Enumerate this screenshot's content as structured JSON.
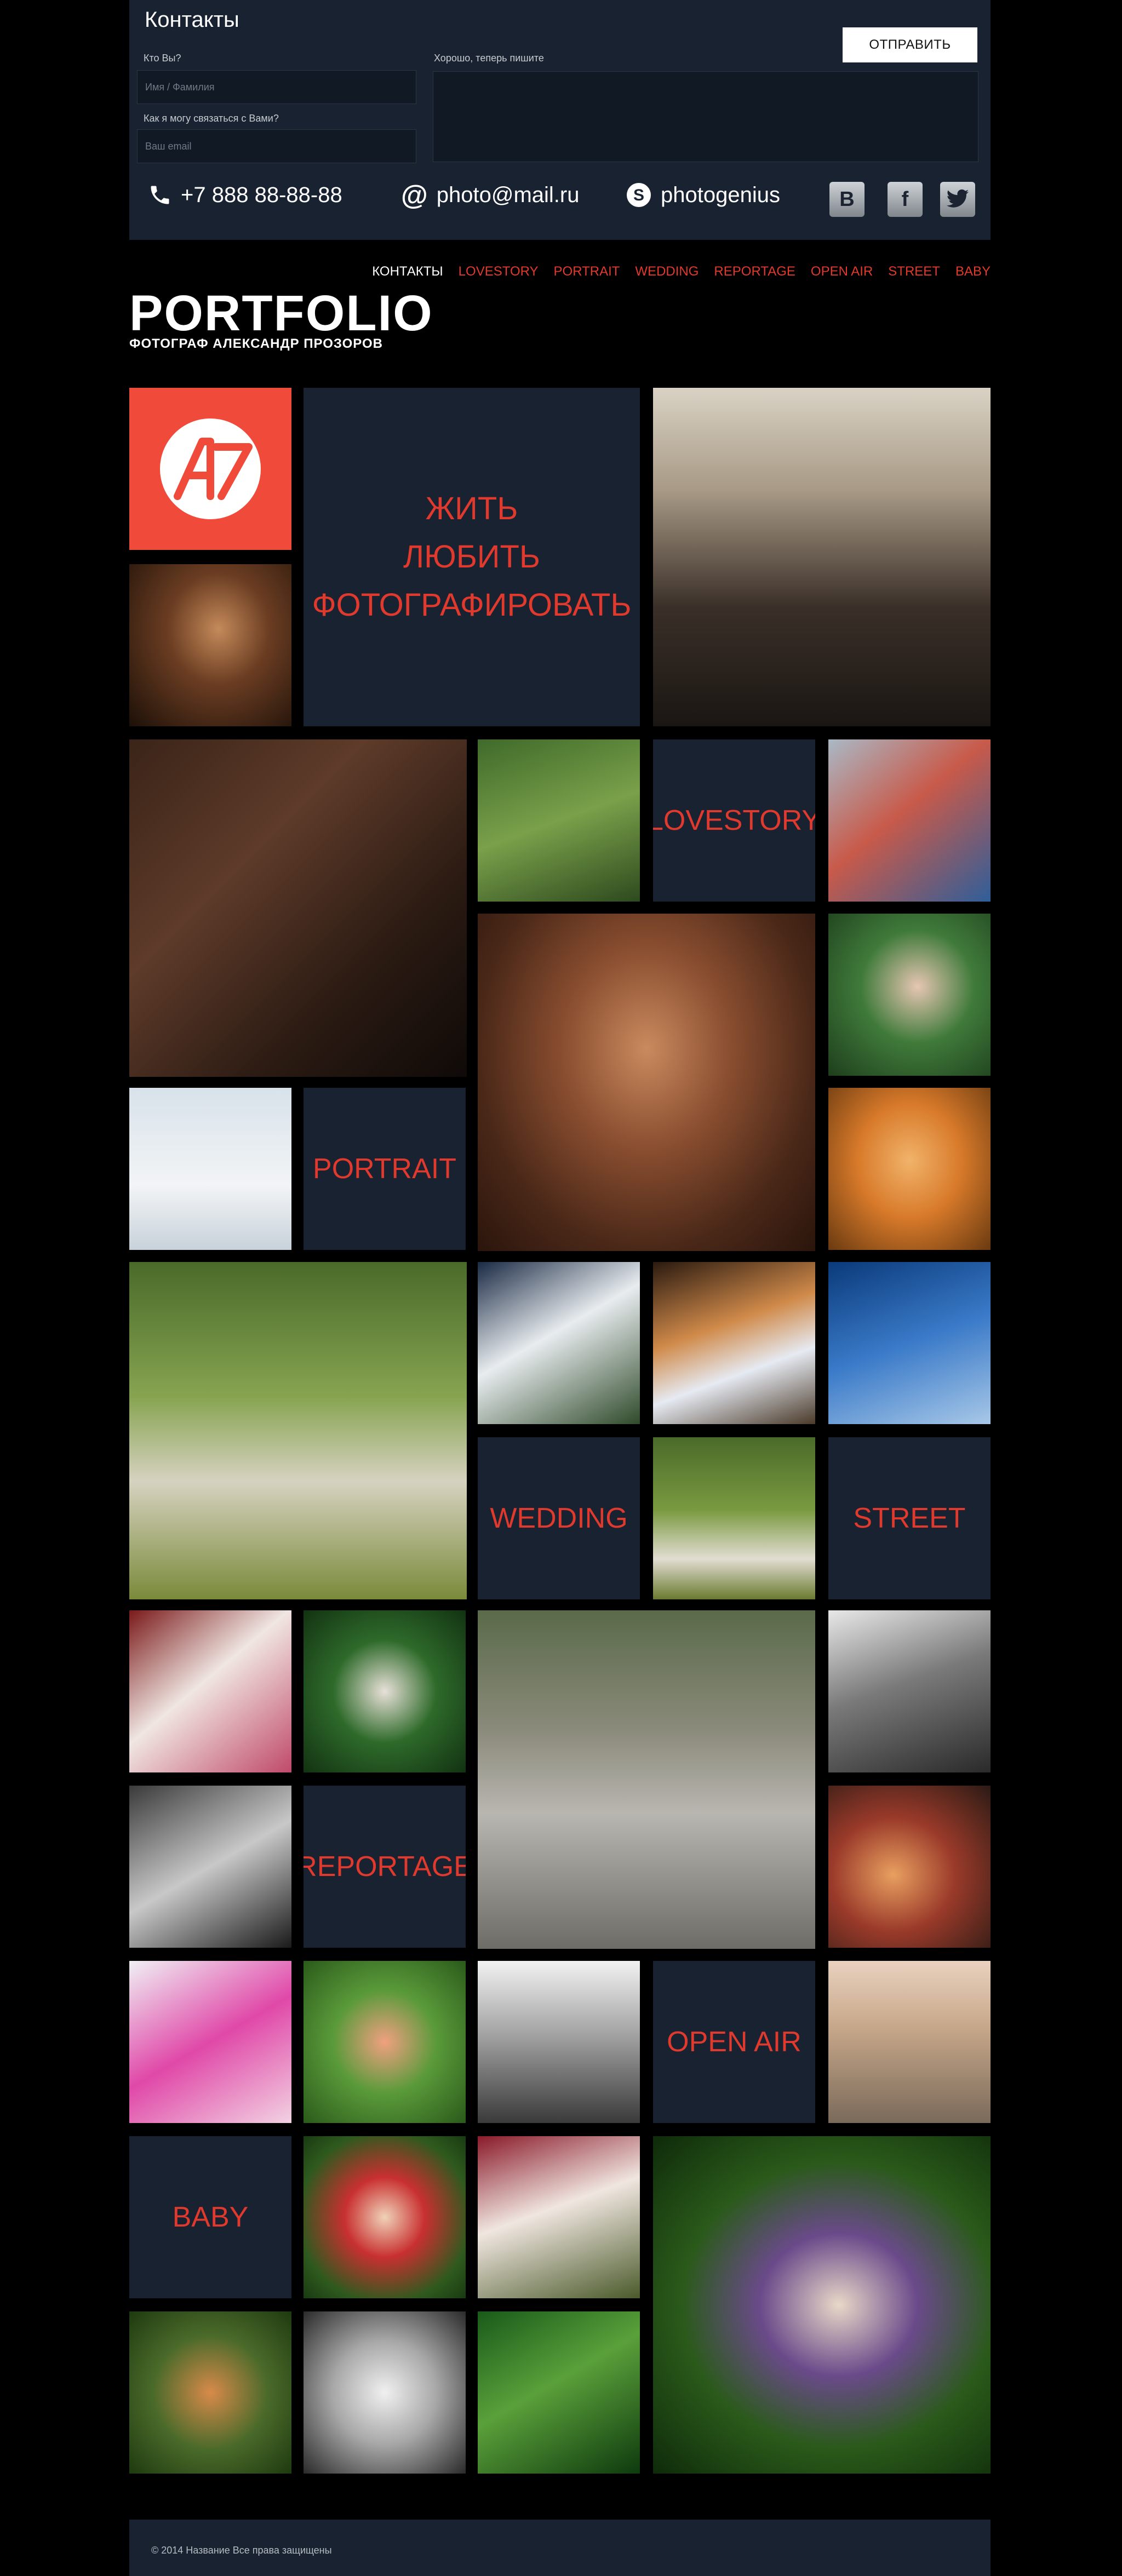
{
  "contact": {
    "title": "Контакты",
    "who_label": "Кто Вы?",
    "name_placeholder": "Имя / Фамилия",
    "how_label": "Как  я могу связаться с Вами?",
    "email_placeholder": "Ваш email",
    "message_label": "Хорошо, теперь пишите",
    "send_label": "ОТПРАВИТЬ",
    "phone": "+7 888 88-88-88",
    "email": "photo@mail.ru",
    "skype": "photogenius",
    "socials": [
      "vk-icon",
      "facebook-icon",
      "twitter-icon"
    ]
  },
  "nav": {
    "items": [
      "КОНТАКТЫ",
      "LOVESTORY",
      "PORTRAIT",
      "WEDDING",
      "REPORTAGE",
      "OPEN AIR",
      "STREET",
      "BABY"
    ],
    "active_index": 0
  },
  "logo": {
    "title": "PORTFOLIO",
    "subtitle": "ФОТОГРАФ АЛЕКСАНДР ПРОЗОРОВ"
  },
  "hero": {
    "tagline_lines": [
      "ЖИТЬ",
      "ЛЮБИТЬ",
      "ФОТОГРАФИРОВАТЬ"
    ],
    "logo_mark": "logo-mark"
  },
  "categories": {
    "lovestory": "LOVESTORY",
    "portrait": "PORTRAIT",
    "wedding": "WEDDING",
    "street": "STREET",
    "reportage": "REPORTAGE",
    "open_air": "OPEN AIR",
    "baby": "BABY"
  },
  "footer": {
    "text": "© 2014 Название Все права защищены"
  },
  "colors": {
    "accent": "#e0392d",
    "panel": "#182230",
    "background": "#000000"
  }
}
